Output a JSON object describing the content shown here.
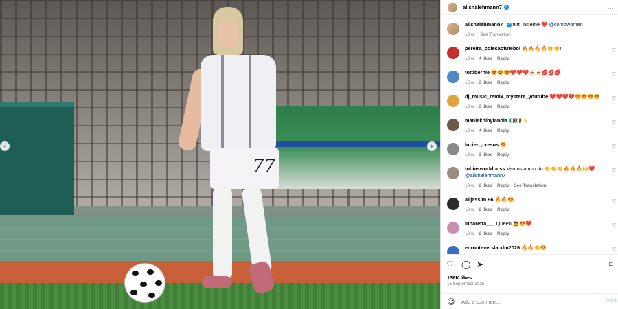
{
  "post": {
    "username": "alishalehmann7",
    "verified": true,
    "more_icon": "…",
    "caption_text": "tutti insieme ❤️",
    "caption_mention": "@comowomen",
    "caption_time": "18 w",
    "caption_translate": "See Translation"
  },
  "comments": [
    {
      "user": "pereira_colecaofutebol",
      "text": "🔥🔥🔥🔥👏👏!!",
      "time": "18 w",
      "likes": "4 likes",
      "reply": "Reply",
      "translate": "",
      "avatar_color": "#c4302b"
    },
    {
      "user": "tottibernie",
      "text": "😍😍😍❤️❤️❤️🍝🍝💋💋💋",
      "time": "15 w",
      "likes": "3 likes",
      "reply": "Reply",
      "translate": "",
      "avatar_color": "#4f86c6"
    },
    {
      "user": "dj_music_remix_mystere_youtube",
      "text": "❤️❤️❤️❤️😍😍😍😍",
      "time": "18 w",
      "likes": "3 likes",
      "reply": "Reply",
      "translate": "",
      "avatar_color": "#e0a340"
    },
    {
      "user": "manieknibylandia",
      "text": "🇮🇹🇮🇹✨",
      "time": "18 w",
      "likes": "4 likes",
      "reply": "Reply",
      "translate": "",
      "avatar_color": "#6b5a4a"
    },
    {
      "user": "lucien_cresus",
      "text": "😍",
      "time": "18 w",
      "likes": "3 likes",
      "reply": "Reply",
      "translate": "",
      "avatar_color": "#8a8a8a"
    },
    {
      "user": "tobiasworldboss",
      "text": "Vamos amorcito 👏👏👏🔥🔥🔥🙌❤️",
      "text2": "@alishalehmann7",
      "time": "10 w",
      "likes": "2 likes",
      "reply": "Reply",
      "translate": "See Translation",
      "avatar_color": "#9c8f7f"
    },
    {
      "user": "alijassim.96",
      "text": "🔥🔥😍",
      "time": "18 w",
      "likes": "2 likes",
      "reply": "Reply",
      "translate": "",
      "avatar_color": "#2b2b2b"
    },
    {
      "user": "lunaretta___",
      "text": "Queen 🙇😍❤️",
      "time": "18 w",
      "likes": "2 likes",
      "reply": "Reply",
      "translate": "",
      "avatar_color": "#c98fb0"
    },
    {
      "user": "enrouteverslacdm2026",
      "text": "🔥🔥👏😍",
      "time": "",
      "likes": "",
      "reply": "",
      "translate": "",
      "avatar_color": "#3a6fc4"
    }
  ],
  "actions": {
    "like_icon": "heart-outline",
    "comment_icon": "comment-bubble",
    "share_icon": "paper-plane",
    "save_icon": "bookmark"
  },
  "likes_count": "136K likes",
  "post_date": "15 September 2025",
  "add_comment": {
    "placeholder": "Add a comment…",
    "post_label": "Post"
  },
  "colors": {
    "accent": "#0095f6",
    "link": "#00376b",
    "muted": "#737373",
    "post_disabled": "#b3dbff"
  }
}
